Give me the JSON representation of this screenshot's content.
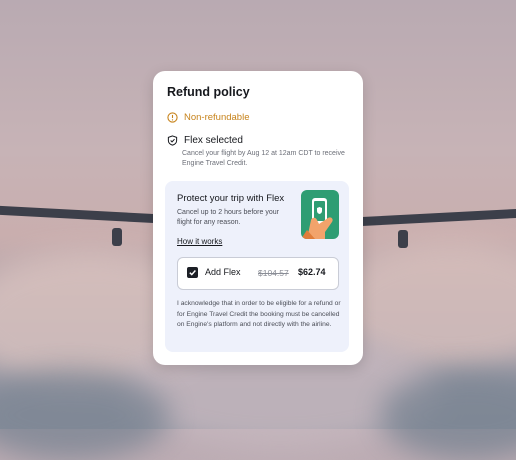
{
  "card": {
    "title": "Refund policy",
    "non_refundable_label": "Non-refundable",
    "flex_selected_label": "Flex selected",
    "flex_selected_desc": "Cancel your flight by Aug 12 at 12am CDT to receive Engine Travel Credit.",
    "protect": {
      "title": "Protect your trip with Flex",
      "description": "Cancel up to 2 hours before your flight for any reason.",
      "how_it_works": "How it works",
      "add_flex_label": "Add Flex",
      "add_flex_checked": true,
      "old_price": "$104.57",
      "new_price": "$62.74",
      "acknowledgement": "I acknowledge that in order to be eligible for a refund or for Engine Travel Credit the booking must be cancelled on Engine's platform and not directly with the airline."
    }
  },
  "colors": {
    "warning": "#c7831b",
    "flex_tile": "#2e9d73",
    "panel_bg": "#eef1fb"
  },
  "icons": {
    "non_refundable": "info-circle-icon",
    "flex": "shield-check-icon",
    "checkbox": "checkmark-icon",
    "phone": "phone-in-hand-icon"
  }
}
